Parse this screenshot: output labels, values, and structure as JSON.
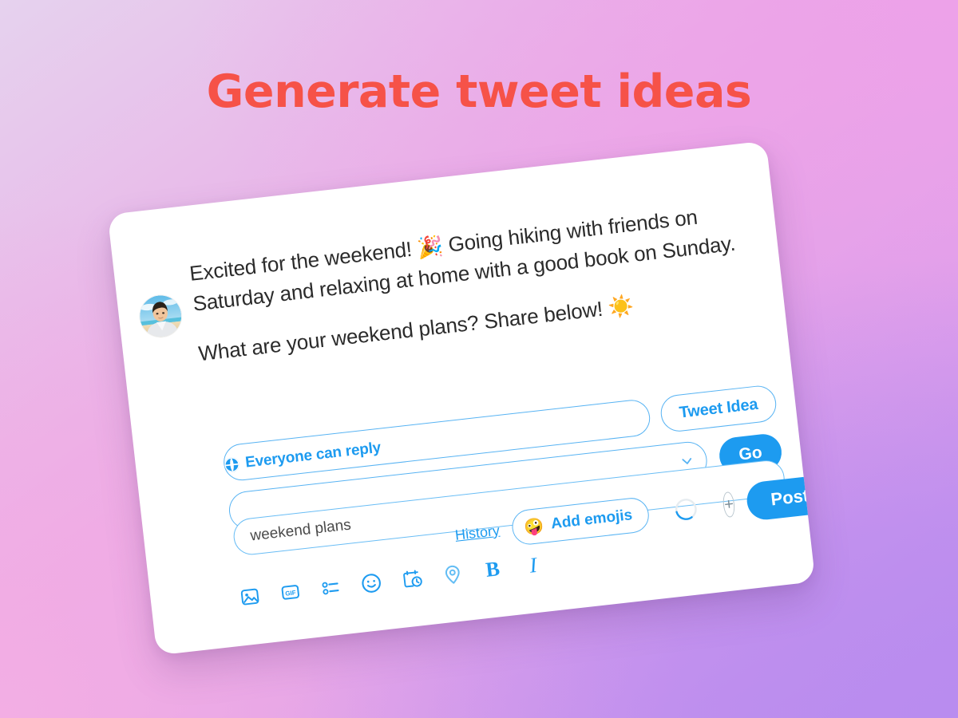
{
  "page": {
    "title": "Generate tweet ideas",
    "title_color": "#f65248",
    "background_colors": [
      "#e6d2ee",
      "#eaa8e6",
      "#d49bec",
      "#bb8cee"
    ]
  },
  "card": {
    "accent_color": "#1d9bf0",
    "compose": {
      "avatar_alt": "user-avatar-photo",
      "tweet_paragraph_1": "Excited for the weekend! 🎉 Going hiking with friends on Saturday and relaxing at home with a good book on Sunday.",
      "tweet_paragraph_2": "What are your weekend plans? Share below! ☀️"
    },
    "reply_scope": {
      "icon": "globe-icon",
      "label": "Everyone can reply"
    },
    "idea_row": {
      "tweet_idea_label": "Tweet Idea",
      "go_label": "Go",
      "dropdown_icon": "chevron-down-icon",
      "dropdown_value": ""
    },
    "prompt_input": {
      "value": "weekend plans",
      "placeholder": "weekend plans"
    },
    "actions": {
      "history_label": "History",
      "add_emojis_label": "Add emojis",
      "add_emojis_icon": "🤪",
      "counter_icon": "character-count-ring",
      "add_thread_icon": "+",
      "post_label": "Post"
    },
    "toolbar": [
      {
        "name": "media-icon",
        "label": "Media"
      },
      {
        "name": "gif-icon",
        "label": "GIF"
      },
      {
        "name": "poll-icon",
        "label": "Poll"
      },
      {
        "name": "emoji-icon",
        "label": "Emoji"
      },
      {
        "name": "schedule-icon",
        "label": "Schedule"
      },
      {
        "name": "location-icon",
        "label": "Location"
      },
      {
        "name": "bold-icon",
        "label": "B"
      },
      {
        "name": "italic-icon",
        "label": "I"
      }
    ]
  }
}
